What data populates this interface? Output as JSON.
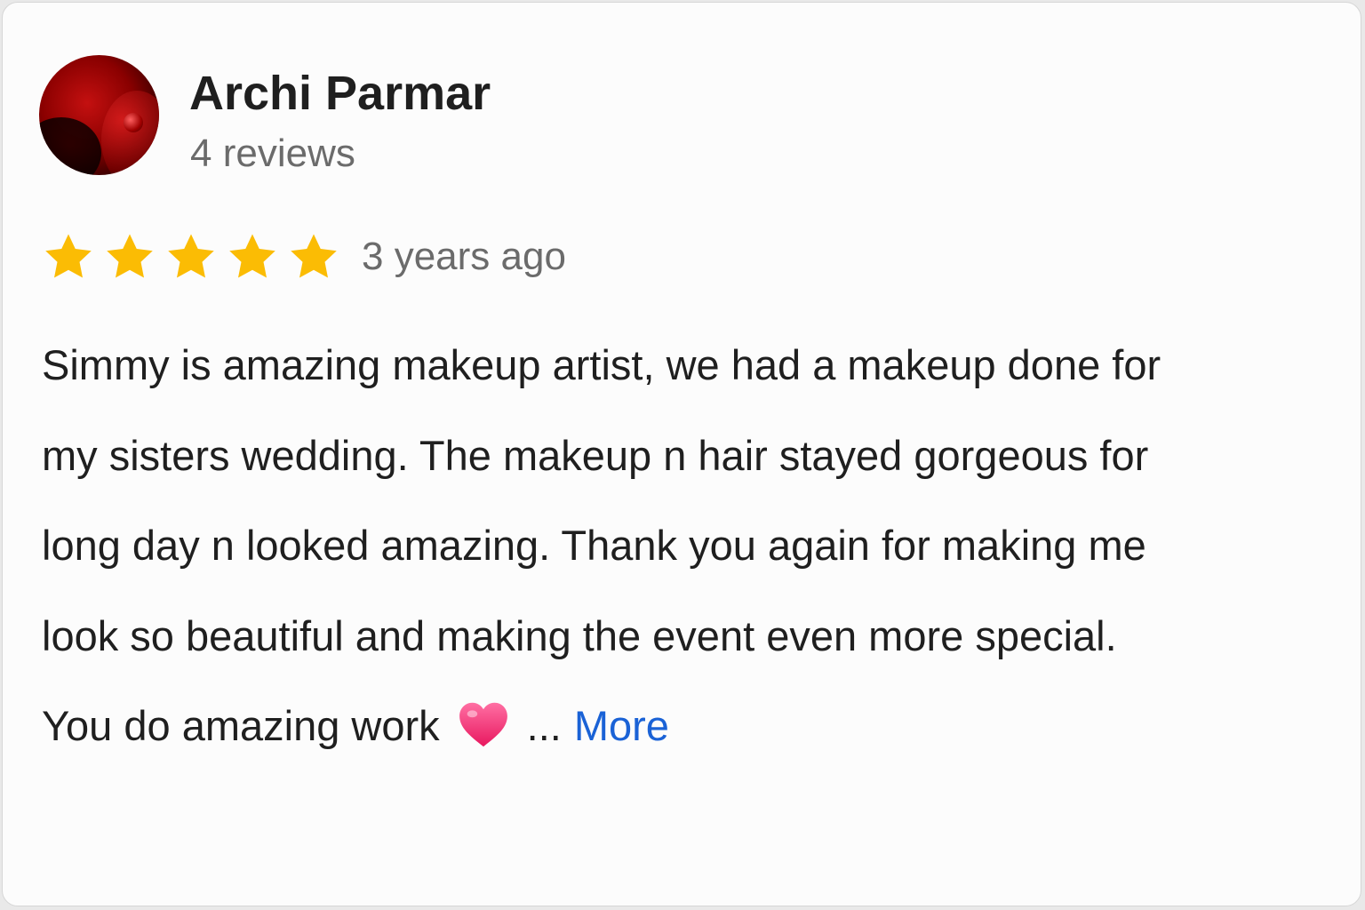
{
  "reviewer": {
    "name": "Archi Parmar",
    "review_count": "4 reviews"
  },
  "rating": {
    "stars": 5,
    "max_stars": 5,
    "star_color": "#fbbc04"
  },
  "time_ago": "3 years ago",
  "review": {
    "lines": [
      "Simmy is amazing makeup artist, we had a makeup done for",
      "my sisters wedding. The makeup n hair stayed gorgeous for",
      "long day n looked amazing. Thank you again for making me",
      "look so beautiful and making the event even more special.",
      "You do amazing work"
    ],
    "emoji": "heart-icon",
    "ellipsis": "...",
    "more_label": "More"
  },
  "colors": {
    "link": "#1a62d6",
    "text": "#1f1f1f",
    "secondary_text": "#6b6b6b",
    "heart": "#f03b7a"
  }
}
